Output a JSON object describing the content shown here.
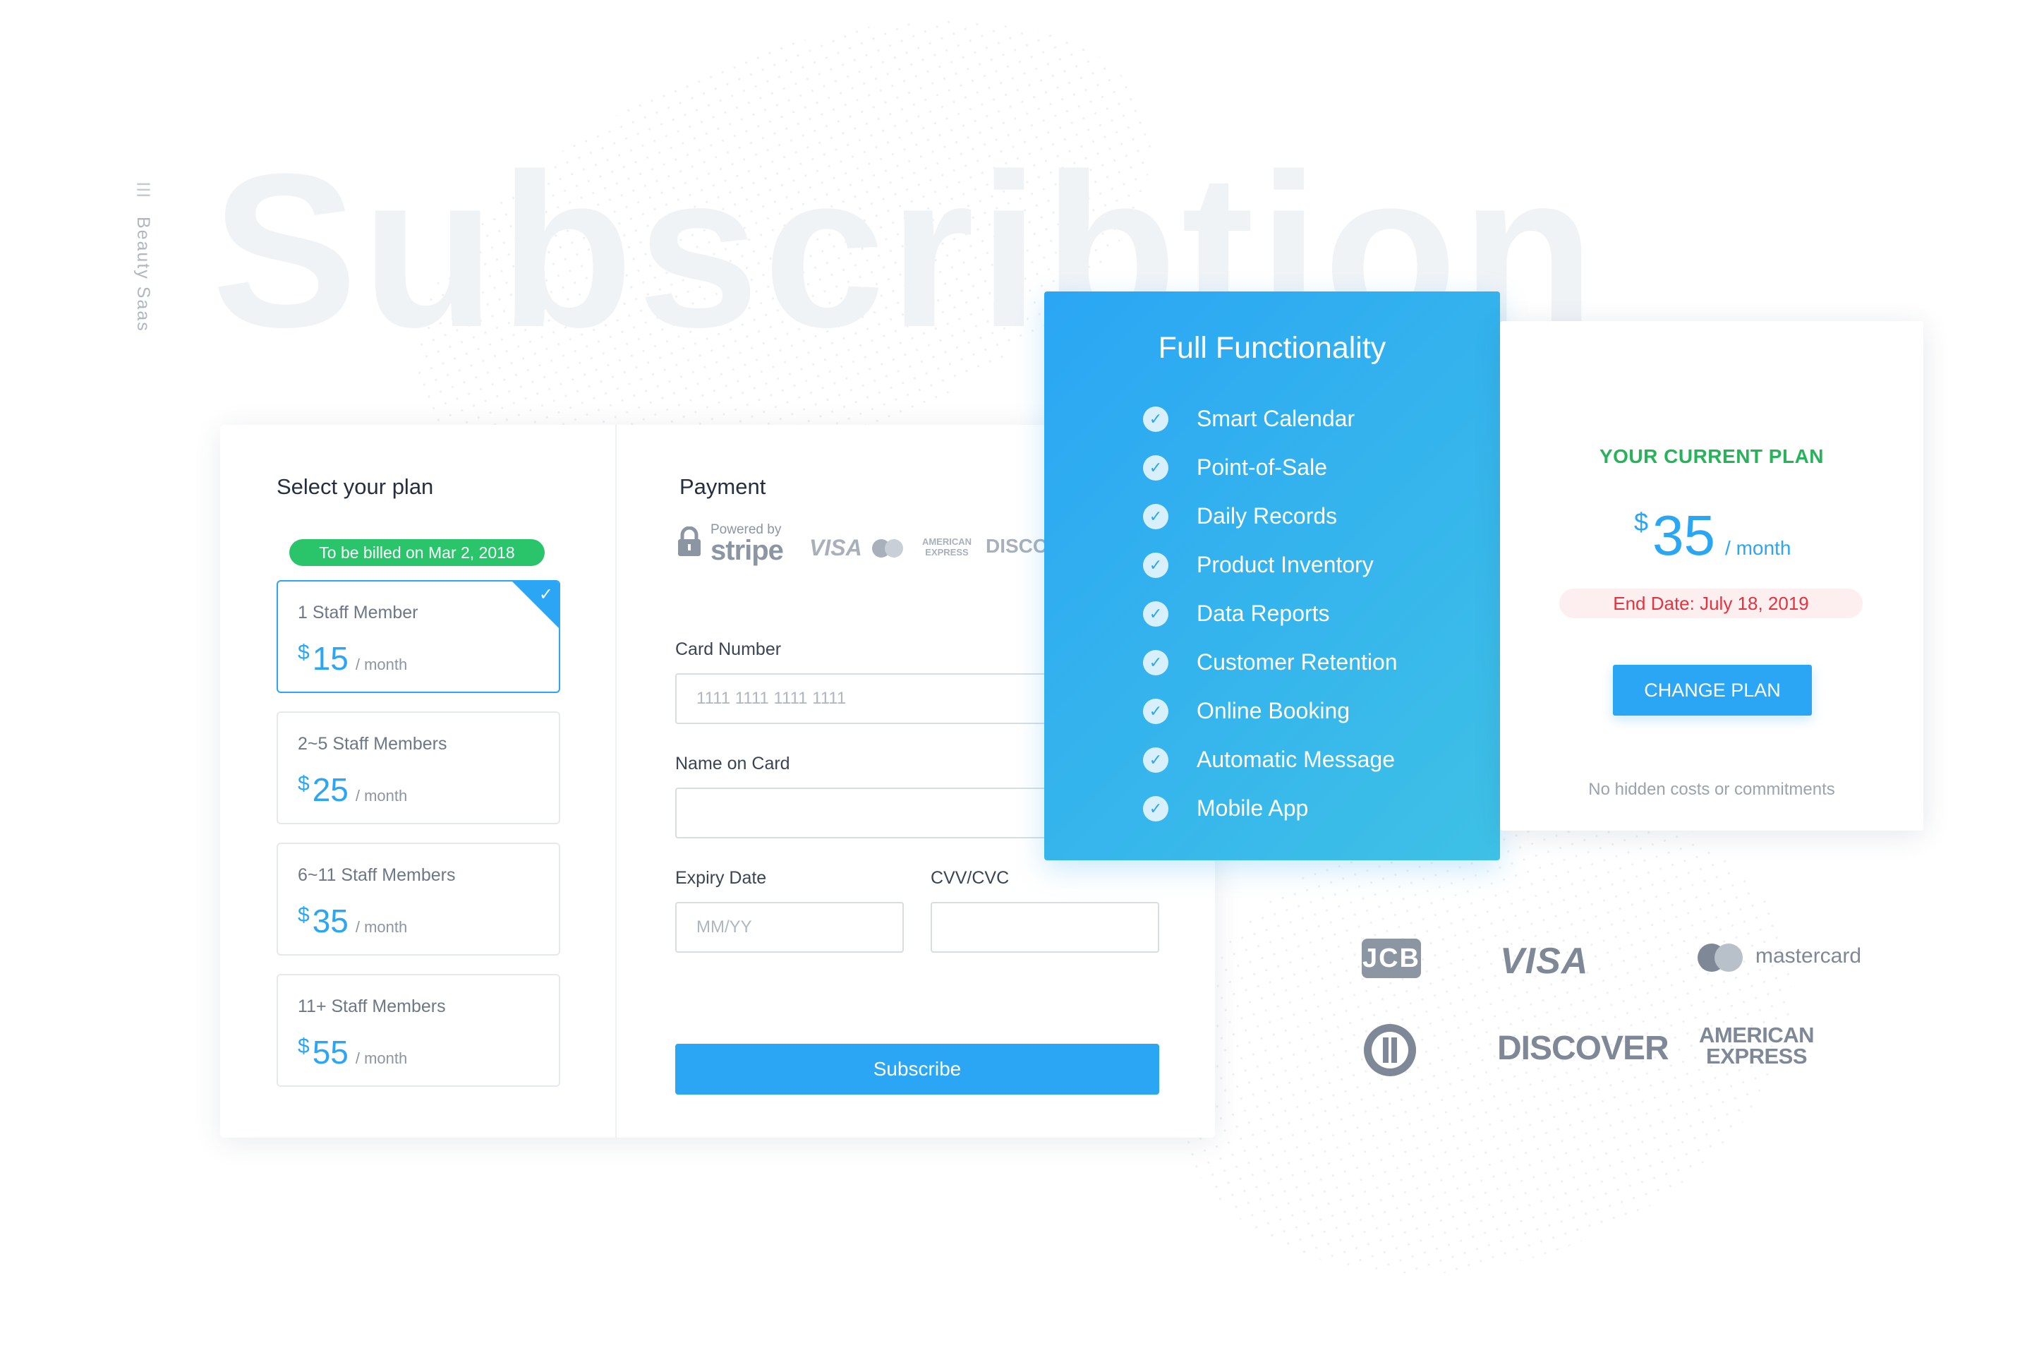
{
  "brand": {
    "name": "Beauty Saas"
  },
  "background_title": "Subscribtion",
  "plan_section": {
    "title": "Select your plan",
    "billed_badge": "To be billed on Mar 2, 2018",
    "options": [
      {
        "name": "1 Staff Member",
        "currency": "$",
        "amount": "15",
        "period": "/ month",
        "selected": true
      },
      {
        "name": "2~5 Staff Members",
        "currency": "$",
        "amount": "25",
        "period": "/ month",
        "selected": false
      },
      {
        "name": "6~11 Staff Members",
        "currency": "$",
        "amount": "35",
        "period": "/ month",
        "selected": false
      },
      {
        "name": "11+ Staff Members",
        "currency": "$",
        "amount": "55",
        "period": "/ month",
        "selected": false
      }
    ]
  },
  "payment": {
    "title": "Payment",
    "powered_by": "Powered by",
    "provider": "stripe",
    "mini_logos": [
      "VISA",
      "AMERICAN EXPRESS",
      "DISCO"
    ],
    "card_number": {
      "label": "Card Number",
      "placeholder": "1111 1111 1111 1111"
    },
    "name_on_card": {
      "label": "Name on Card",
      "placeholder": ""
    },
    "expiry": {
      "label": "Expiry Date",
      "placeholder": "MM/YY"
    },
    "cvv": {
      "label": "CVV/CVC",
      "placeholder": ""
    },
    "subscribe_label": "Subscribe"
  },
  "features": {
    "title": "Full Functionality",
    "items": [
      "Smart Calendar",
      "Point-of-Sale",
      "Daily Records",
      "Product Inventory",
      "Data Reports",
      "Customer Retention",
      "Online Booking",
      "Automatic Message",
      "Mobile App"
    ]
  },
  "current_plan": {
    "label": "YOUR CURRENT PLAN",
    "currency": "$",
    "amount": "35",
    "period": "/ month",
    "end_date": "End Date: July 18, 2019",
    "change_label": "CHANGE PLAN",
    "note": "No hidden costs or commitments"
  },
  "card_logos": {
    "jcb": "JCB",
    "visa": "VISA",
    "mastercard": "mastercard",
    "discover": "DISCOVER",
    "amex_line1": "AMERICAN",
    "amex_line2": "EXPRESS"
  },
  "colors": {
    "accent": "#2aa6f4",
    "success": "#2ac46a",
    "danger": "#e0343f"
  }
}
